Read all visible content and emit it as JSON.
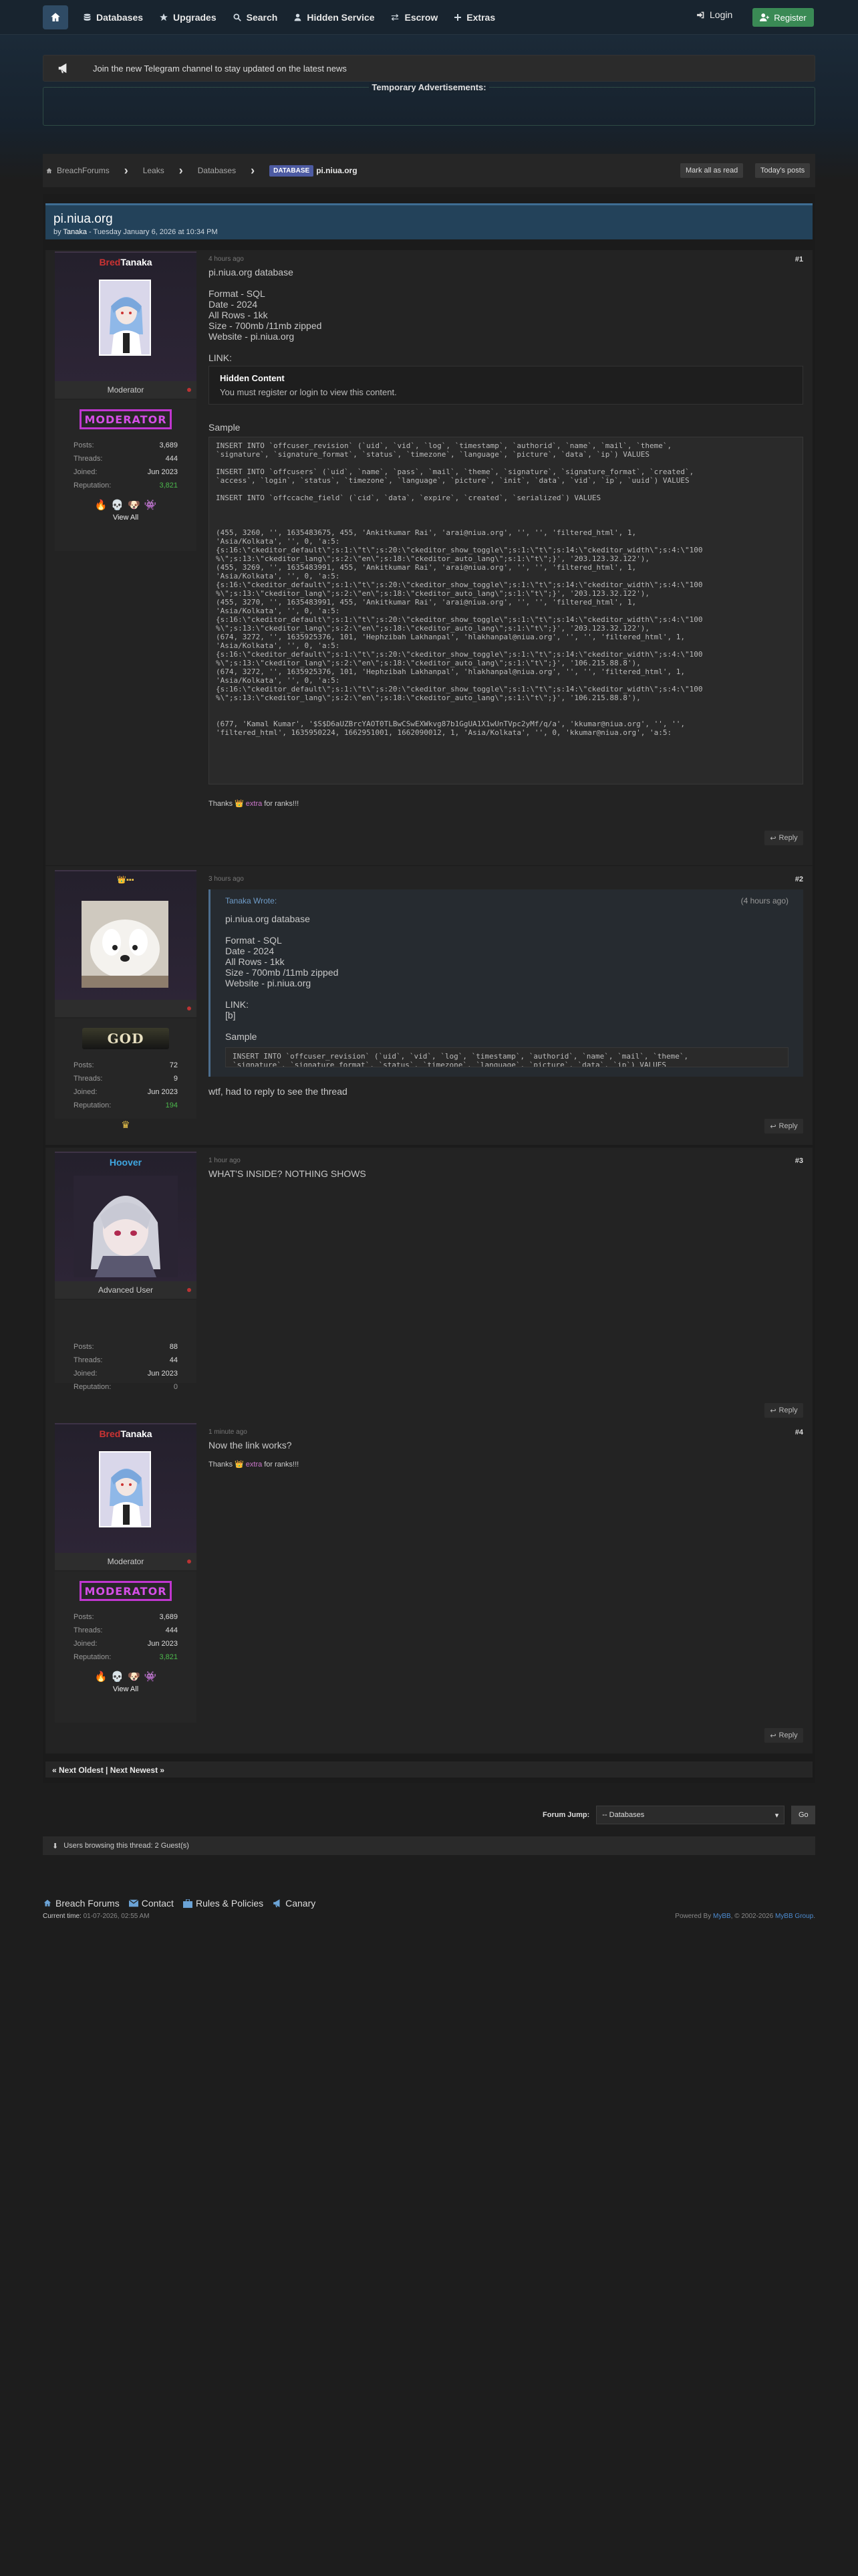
{
  "nav": {
    "items": [
      "Databases",
      "Upgrades",
      "Search",
      "Hidden Service",
      "Escrow",
      "Extras"
    ],
    "login": "Login",
    "register": "Register"
  },
  "announcement": "Join the new Telegram channel to stay updated on the latest news",
  "temp_ads": "Temporary Advertisements:",
  "breadcrumb": {
    "items": [
      "BreachForums",
      "Leaks",
      "Databases"
    ],
    "tag": "DATABASE",
    "current": "pi.niua.org"
  },
  "buttons": {
    "mark_read": "Mark all as read",
    "todays_posts": "Today's posts",
    "reply": "Reply"
  },
  "thread": {
    "title": "pi.niua.org",
    "by": "by",
    "author": "Tanaka",
    "date": " - Tuesday January 6, 2026 at 10:34 PM"
  },
  "posts": [
    {
      "num": "#1",
      "time": "4 hours ago",
      "author": {
        "prefix": "Bred",
        "name": "Tanaka",
        "role": "Moderator",
        "badge": "MODERATOR",
        "stats": [
          [
            "Posts:",
            "3,689"
          ],
          [
            "Threads:",
            "444"
          ],
          [
            "Joined:",
            "Jun 2023"
          ],
          [
            "Reputation:",
            "3,821"
          ]
        ],
        "view_all": "View All"
      },
      "lines": [
        "pi.niua.org database",
        "",
        "Format - SQL",
        "Date - 2024",
        "All Rows - 1kk",
        "Size - 700mb /11mb zipped",
        "Website - pi.niua.org",
        "",
        "LINK:"
      ],
      "hidden": {
        "title": "Hidden Content",
        "msg": "You must register or login to view this content."
      },
      "sample_label": "Sample",
      "code": "INSERT INTO `offcuser_revision` (`uid`, `vid`, `log`, `timestamp`, `authorid`, `name`, `mail`, `theme`,\n`signature`, `signature_format`, `status`, `timezone`, `language`, `picture`, `data`, `ip`) VALUES\n\nINSERT INTO `offcusers` (`uid`, `name`, `pass`, `mail`, `theme`, `signature`, `signature_format`, `created`,\n`access`, `login`, `status`, `timezone`, `language`, `picture`, `init`, `data`, `vid`, `ip`, `uuid`) VALUES\n\nINSERT INTO `offccache_field` (`cid`, `data`, `expire`, `created`, `serialized`) VALUES\n\n\n\n(455, 3260, '', 1635483675, 455, 'Ankitkumar Rai', 'arai@niua.org', '', '', 'filtered_html', 1,\n'Asia/Kolkata', '', 0, 'a:5:\n{s:16:\\\"ckeditor_default\\\";s:1:\\\"t\\\";s:20:\\\"ckeditor_show_toggle\\\";s:1:\\\"t\\\";s:14:\\\"ckeditor_width\\\";s:4:\\\"100\n%\\\";s:13:\\\"ckeditor_lang\\\";s:2:\\\"en\\\";s:18:\\\"ckeditor_auto_lang\\\";s:1:\\\"t\\\";}', '203.123.32.122'),\n(455, 3269, '', 1635483991, 455, 'Ankitkumar Rai', 'arai@niua.org', '', '', 'filtered_html', 1,\n'Asia/Kolkata', '', 0, 'a:5:\n{s:16:\\\"ckeditor_default\\\";s:1:\\\"t\\\";s:20:\\\"ckeditor_show_toggle\\\";s:1:\\\"t\\\";s:14:\\\"ckeditor_width\\\";s:4:\\\"100\n%\\\";s:13:\\\"ckeditor_lang\\\";s:2:\\\"en\\\";s:18:\\\"ckeditor_auto_lang\\\";s:1:\\\"t\\\";}', '203.123.32.122'),\n(455, 3270, '', 1635483991, 455, 'Ankitkumar Rai', 'arai@niua.org', '', '', 'filtered_html', 1,\n'Asia/Kolkata', '', 0, 'a:5:\n{s:16:\\\"ckeditor_default\\\";s:1:\\\"t\\\";s:20:\\\"ckeditor_show_toggle\\\";s:1:\\\"t\\\";s:14:\\\"ckeditor_width\\\";s:4:\\\"100\n%\\\";s:13:\\\"ckeditor_lang\\\";s:2:\\\"en\\\";s:18:\\\"ckeditor_auto_lang\\\";s:1:\\\"t\\\";}', '203.123.32.122'),\n(674, 3272, '', 1635925376, 101, 'Hephzibah Lakhanpal', 'hlakhanpal@niua.org', '', '', 'filtered_html', 1,\n'Asia/Kolkata', '', 0, 'a:5:\n{s:16:\\\"ckeditor_default\\\";s:1:\\\"t\\\";s:20:\\\"ckeditor_show_toggle\\\";s:1:\\\"t\\\";s:14:\\\"ckeditor_width\\\";s:4:\\\"100\n%\\\";s:13:\\\"ckeditor_lang\\\";s:2:\\\"en\\\";s:18:\\\"ckeditor_auto_lang\\\";s:1:\\\"t\\\";}', '106.215.88.8'),\n(674, 3272, '', 1635925376, 101, 'Hephzibah Lakhanpal', 'hlakhanpal@niua.org', '', '', 'filtered_html', 1,\n'Asia/Kolkata', '', 0, 'a:5:\n{s:16:\\\"ckeditor_default\\\";s:1:\\\"t\\\";s:20:\\\"ckeditor_show_toggle\\\";s:1:\\\"t\\\";s:14:\\\"ckeditor_width\\\";s:4:\\\"100\n%\\\";s:13:\\\"ckeditor_lang\\\";s:2:\\\"en\\\";s:18:\\\"ckeditor_auto_lang\\\";s:1:\\\"t\\\";}', '106.215.88.8'),\n\n\n(677, 'Kamal Kumar', '$S$D6aUZBrcYAOT0TLBwCSwEXWkvg87b1GgUA1X1wUnTVpc2yMf/q/a', 'kkumar@niua.org', '', '',\n'filtered_html', 1635950224, 1662951001, 1662090012, 1, 'Asia/Kolkata', '', 0, 'kkumar@niua.org', 'a:5:",
      "thanks": {
        "pre": "Thanks",
        "user": "extra",
        "post": "for ranks!!!"
      }
    },
    {
      "num": "#2",
      "time": "3 hours ago",
      "author": {
        "prefix": "",
        "name": "",
        "role": "",
        "badge": "GOD",
        "stats": [
          [
            "Posts:",
            "72"
          ],
          [
            "Threads:",
            "9"
          ],
          [
            "Joined:",
            "Jun 2023"
          ],
          [
            "Reputation:",
            "194"
          ]
        ]
      },
      "quote": {
        "author": "Tanaka Wrote:",
        "time": "(4 hours ago)",
        "lines": [
          "pi.niua.org database",
          "",
          "Format - SQL",
          "Date - 2024",
          "All Rows - 1kk",
          "Size - 700mb /11mb zipped",
          "Website - pi.niua.org",
          "",
          "LINK:",
          "[b]",
          "",
          "Sample"
        ],
        "code": "INSERT INTO `offcuser_revision` (`uid`, `vid`, `log`, `timestamp`, `authorid`, `name`, `mail`, `theme`,\n`signature`, `signature_format`, `status`, `timezone`, `language`, `picture`, `data`, `ip`) VALUES"
      },
      "text": "wtf, had to reply to see the thread"
    },
    {
      "num": "#3",
      "time": "1 hour ago",
      "author": {
        "prefix": "",
        "name": "Hoover",
        "role": "Advanced User",
        "stats": [
          [
            "Posts:",
            "88"
          ],
          [
            "Threads:",
            "44"
          ],
          [
            "Joined:",
            "Jun 2023"
          ],
          [
            "Reputation:",
            "0"
          ]
        ]
      },
      "text": "WHAT'S INSIDE? NOTHING SHOWS"
    },
    {
      "num": "#4",
      "time": "1 minute ago",
      "author": {
        "prefix": "Bred",
        "name": "Tanaka",
        "role": "Moderator",
        "badge": "MODERATOR",
        "stats": [
          [
            "Posts:",
            "3,689"
          ],
          [
            "Threads:",
            "444"
          ],
          [
            "Joined:",
            "Jun 2023"
          ],
          [
            "Reputation:",
            "3,821"
          ]
        ],
        "view_all": "View All"
      },
      "text": "Now the link works?",
      "thanks": {
        "pre": "Thanks",
        "user": "extra",
        "post": "for ranks!!!"
      }
    }
  ],
  "pagination": "« Next Oldest | Next Newest »",
  "forum_jump": {
    "label": "Forum Jump:",
    "selected": "-- Databases",
    "go": "Go"
  },
  "browsing": "Users browsing this thread: 2 Guest(s)",
  "footer": {
    "links": [
      "Breach Forums",
      "Contact",
      "Rules & Policies",
      "Canary"
    ],
    "time_label": "Current time:",
    "time": "01-07-2026, 02:55 AM",
    "powered": "Powered By",
    "mybb": "MyBB",
    "copy": ", © 2002-2026",
    "group": "MyBB Group",
    "period": "."
  },
  "colors": {
    "accent": "#3e6d93",
    "register": "#3a8a55",
    "moderator": "#c036d0",
    "rep": "#4cb84c"
  }
}
